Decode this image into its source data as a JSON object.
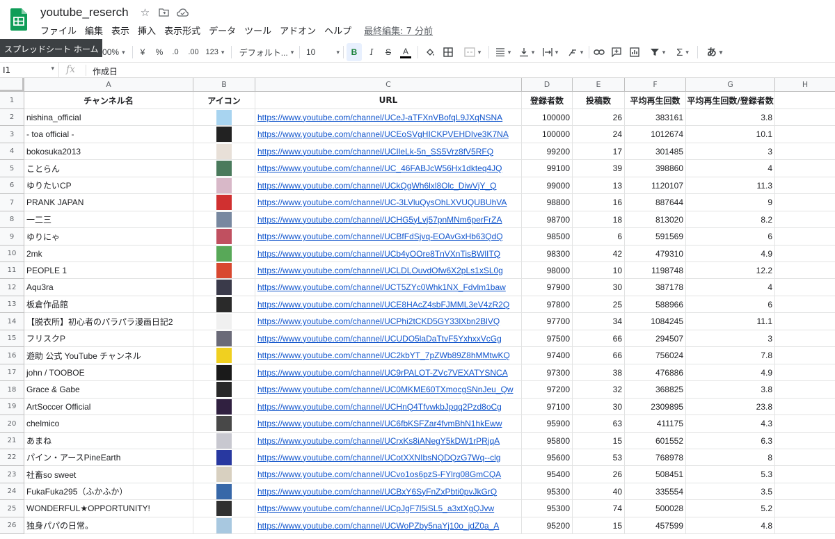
{
  "app": {
    "doc_title": "youtube_reserch",
    "menus": [
      "ファイル",
      "編集",
      "表示",
      "挿入",
      "表示形式",
      "データ",
      "ツール",
      "アドオン",
      "ヘルプ"
    ],
    "last_edit": "最終編集: 7 分前",
    "tooltip": "スプレッドシート ホーム"
  },
  "toolbar": {
    "zoom": "100%",
    "currency": "¥",
    "percent": "%",
    "dec_decrease": ".0",
    "dec_increase": ".00",
    "format_more": "123",
    "font": "デフォルト...",
    "font_size": "10",
    "bold": "B",
    "italic": "I",
    "strike": "S",
    "text_color": "A",
    "input_tools": "あ"
  },
  "formula": {
    "cell_ref": "I1",
    "fx": "fx",
    "content": "作成日"
  },
  "columns": [
    "A",
    "B",
    "C",
    "D",
    "E",
    "F",
    "G",
    "H"
  ],
  "headers": {
    "name": "チャンネル名",
    "icon": "アイコン",
    "url": "URL",
    "subs": "登録者数",
    "posts": "投稿数",
    "avg": "平均再生回数",
    "ratio": "平均再生回数/登録者数"
  },
  "rows": [
    {
      "n": "2",
      "name": "nishina_official",
      "url": "https://www.youtube.com/channel/UCeJ-aTFXnVBofqL9JXqNSNA",
      "subs": "100000",
      "posts": "26",
      "avg": "383161",
      "ratio": "3.8",
      "color": "#a8d4f0"
    },
    {
      "n": "3",
      "name": "- toa official -",
      "url": "https://www.youtube.com/channel/UCEoSVgHICKPVEHDIve3K7NA",
      "subs": "100000",
      "posts": "24",
      "avg": "1012674",
      "ratio": "10.1",
      "color": "#222222"
    },
    {
      "n": "4",
      "name": "bokosuka2013",
      "url": "https://www.youtube.com/channel/UCIleLk-5n_SS5Vrz8fV5RFQ",
      "subs": "99200",
      "posts": "17",
      "avg": "301485",
      "ratio": "3",
      "color": "#e8e0d8"
    },
    {
      "n": "5",
      "name": "ことらん",
      "url": "https://www.youtube.com/channel/UC_46FABJcW56Hx1dkteq4JQ",
      "subs": "99100",
      "posts": "39",
      "avg": "398860",
      "ratio": "4",
      "color": "#4a7a5c"
    },
    {
      "n": "6",
      "name": "ゆりたいCP",
      "url": "https://www.youtube.com/channel/UCkQgWh6lxl8Olc_DiwVjY_Q",
      "subs": "99000",
      "posts": "13",
      "avg": "1120107",
      "ratio": "11.3",
      "color": "#d8b8c8"
    },
    {
      "n": "7",
      "name": "PRANK JAPAN",
      "url": "https://www.youtube.com/channel/UC-3LVluQysOhLXVUQUBUhVA",
      "subs": "98800",
      "posts": "16",
      "avg": "887644",
      "ratio": "9",
      "color": "#d03030"
    },
    {
      "n": "8",
      "name": "一二三",
      "url": "https://www.youtube.com/channel/UCHG5yLvj57pnMNm6perFrZA",
      "subs": "98700",
      "posts": "18",
      "avg": "813020",
      "ratio": "8.2",
      "color": "#7888a0"
    },
    {
      "n": "9",
      "name": "ゆりにゃ",
      "url": "https://www.youtube.com/channel/UCBfFdSjvq-EOAvGxHb63QdQ",
      "subs": "98500",
      "posts": "6",
      "avg": "591569",
      "ratio": "6",
      "color": "#c05060"
    },
    {
      "n": "10",
      "name": "2mk",
      "url": "https://www.youtube.com/channel/UCb4yOOre8TnVXnTisBWlITQ",
      "subs": "98300",
      "posts": "42",
      "avg": "479310",
      "ratio": "4.9",
      "color": "#58a858"
    },
    {
      "n": "11",
      "name": "PEOPLE 1",
      "url": "https://www.youtube.com/channel/UCLDLOuvdOfw6X2pLs1xSL0g",
      "subs": "98000",
      "posts": "10",
      "avg": "1198748",
      "ratio": "12.2",
      "color": "#d84830"
    },
    {
      "n": "12",
      "name": "Aqu3ra",
      "url": "https://www.youtube.com/channel/UCT5ZYc0Whk1NX_Fdvlm1baw",
      "subs": "97900",
      "posts": "30",
      "avg": "387178",
      "ratio": "4",
      "color": "#3a3a4a"
    },
    {
      "n": "13",
      "name": "板倉作品館",
      "url": "https://www.youtube.com/channel/UCE8HAcZ4sbFJMML3eV4zR2Q",
      "subs": "97800",
      "posts": "25",
      "avg": "588966",
      "ratio": "6",
      "color": "#2a2a2a"
    },
    {
      "n": "14",
      "name": "【脱衣所】初心者のパラパラ漫画日記2",
      "url": "https://www.youtube.com/channel/UCPhi2tCKD5GY33lXbn2BlVQ",
      "subs": "97700",
      "posts": "34",
      "avg": "1084245",
      "ratio": "11.1",
      "color": "#f0f0f0"
    },
    {
      "n": "15",
      "name": "フリスクP",
      "url": "https://www.youtube.com/channel/UCUDO5laDaTtvF5YxhxxVcGg",
      "subs": "97500",
      "posts": "66",
      "avg": "294507",
      "ratio": "3",
      "color": "#6a6a78"
    },
    {
      "n": "16",
      "name": "遊助 公式 YouTube チャンネル",
      "url": "https://www.youtube.com/channel/UC2kbYT_7pZWb89Z8hMMtwKQ",
      "subs": "97400",
      "posts": "66",
      "avg": "756024",
      "ratio": "7.8",
      "color": "#f0d020"
    },
    {
      "n": "17",
      "name": "john / TOOBOE",
      "url": "https://www.youtube.com/channel/UC9rPALOT-ZVc7VEXATYSNCA",
      "subs": "97300",
      "posts": "38",
      "avg": "476886",
      "ratio": "4.9",
      "color": "#1a1a1a"
    },
    {
      "n": "18",
      "name": "Grace & Gabe",
      "url": "https://www.youtube.com/channel/UC0MKME60TXmocgSNnJeu_Qw",
      "subs": "97200",
      "posts": "32",
      "avg": "368825",
      "ratio": "3.8",
      "color": "#282828"
    },
    {
      "n": "19",
      "name": "ArtSoccer Official",
      "url": "https://www.youtube.com/channel/UCHnQ4TfvwkbJpqq2Pzd8oCg",
      "subs": "97100",
      "posts": "30",
      "avg": "2309895",
      "ratio": "23.8",
      "color": "#302040"
    },
    {
      "n": "20",
      "name": "chelmico",
      "url": "https://www.youtube.com/channel/UC6fbKSFZar4fvmBhN1hkEww",
      "subs": "95900",
      "posts": "63",
      "avg": "411175",
      "ratio": "4.3",
      "color": "#484848"
    },
    {
      "n": "21",
      "name": "あまね",
      "url": "https://www.youtube.com/channel/UCrxKs8iANegY5kDW1rPRjqA",
      "subs": "95800",
      "posts": "15",
      "avg": "601552",
      "ratio": "6.3",
      "color": "#c8c8d0"
    },
    {
      "n": "22",
      "name": "パイン・アースPineEarth",
      "url": "https://www.youtube.com/channel/UCotXXNIbsNQDQzG7Wq--clg",
      "subs": "95600",
      "posts": "53",
      "avg": "768978",
      "ratio": "8",
      "color": "#2838a0"
    },
    {
      "n": "23",
      "name": "社畜so sweet",
      "url": "https://www.youtube.com/channel/UCvo1os6pzS-FYlrg08GmCQA",
      "subs": "95400",
      "posts": "26",
      "avg": "508451",
      "ratio": "5.3",
      "color": "#d8d0c0"
    },
    {
      "n": "24",
      "name": "FukaFuka295（ふかふか）",
      "url": "https://www.youtube.com/channel/UCBxY6SyFnZxPbti0pvJkGrQ",
      "subs": "95300",
      "posts": "40",
      "avg": "335554",
      "ratio": "3.5",
      "color": "#3868a8"
    },
    {
      "n": "25",
      "name": "WONDERFUL★OPPORTUNITY!",
      "url": "https://www.youtube.com/channel/UCpJgF7l5iSL5_a3xtXgQJvw",
      "subs": "95300",
      "posts": "74",
      "avg": "500028",
      "ratio": "5.2",
      "color": "#303030"
    },
    {
      "n": "26",
      "name": "独身パパの日常。",
      "url": "https://www.youtube.com/channel/UCWoPZby5naYj10o_jdZ0a_A",
      "subs": "95200",
      "posts": "15",
      "avg": "457599",
      "ratio": "4.8",
      "color": "#a8c8e0"
    }
  ],
  "colors": {
    "sheets_green": "#0f9d58",
    "link": "#1155cc",
    "header_bg": "#f8f9fa"
  }
}
